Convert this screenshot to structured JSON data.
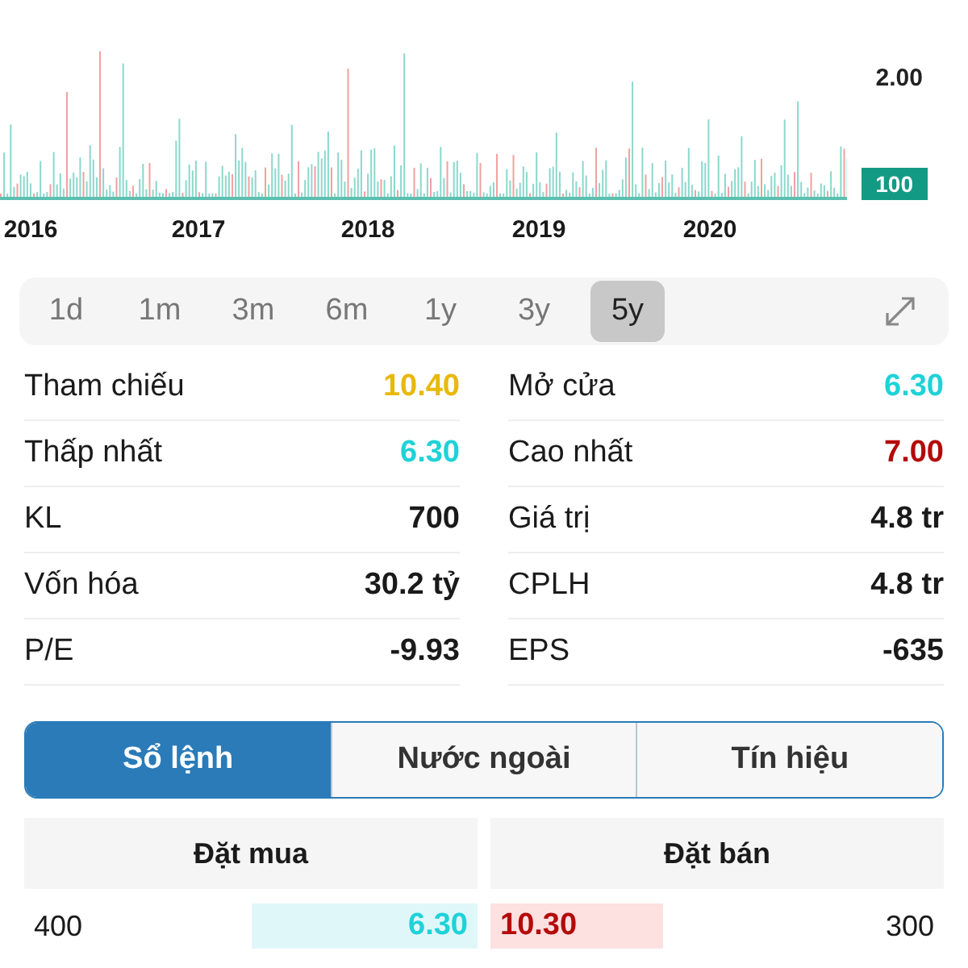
{
  "chart": {
    "y_label": "2.00",
    "last_badge": "100",
    "x_labels": [
      "2016",
      "2017",
      "2018",
      "2019",
      "2020"
    ]
  },
  "ranges": [
    {
      "label": "1d",
      "selected": false
    },
    {
      "label": "1m",
      "selected": false
    },
    {
      "label": "3m",
      "selected": false
    },
    {
      "label": "6m",
      "selected": false
    },
    {
      "label": "1y",
      "selected": false
    },
    {
      "label": "3y",
      "selected": false
    },
    {
      "label": "5y",
      "selected": true
    }
  ],
  "stats": [
    {
      "label": "Tham chiếu",
      "value": "10.40",
      "color": "#e8b80c"
    },
    {
      "label": "Mở cửa",
      "value": "6.30",
      "color": "#1ed2d8"
    },
    {
      "label": "Thấp nhất",
      "value": "6.30",
      "color": "#1ed2d8"
    },
    {
      "label": "Cao nhất",
      "value": "7.00",
      "color": "#b40a0a"
    },
    {
      "label": "KL",
      "value": "700",
      "color": "#1a1a1a"
    },
    {
      "label": "Giá trị",
      "value": "4.8 tr",
      "color": "#1a1a1a"
    },
    {
      "label": "Vốn hóa",
      "value": "30.2 tỷ",
      "color": "#1a1a1a"
    },
    {
      "label": "CPLH",
      "value": "4.8 tr",
      "color": "#1a1a1a"
    },
    {
      "label": "P/E",
      "value": "-9.93",
      "color": "#1a1a1a"
    },
    {
      "label": "EPS",
      "value": "-635",
      "color": "#1a1a1a"
    }
  ],
  "segments": [
    {
      "label": "Sổ lệnh",
      "selected": true
    },
    {
      "label": "Nước ngoài",
      "selected": false
    },
    {
      "label": "Tín hiệu",
      "selected": false
    }
  ],
  "order_book": {
    "buy_header": "Đặt mua",
    "sell_header": "Đặt bán",
    "rows": [
      {
        "buy": {
          "volume": "400",
          "price": "6.30"
        },
        "sell": {
          "price": "10.30",
          "volume": "300"
        }
      }
    ]
  }
}
